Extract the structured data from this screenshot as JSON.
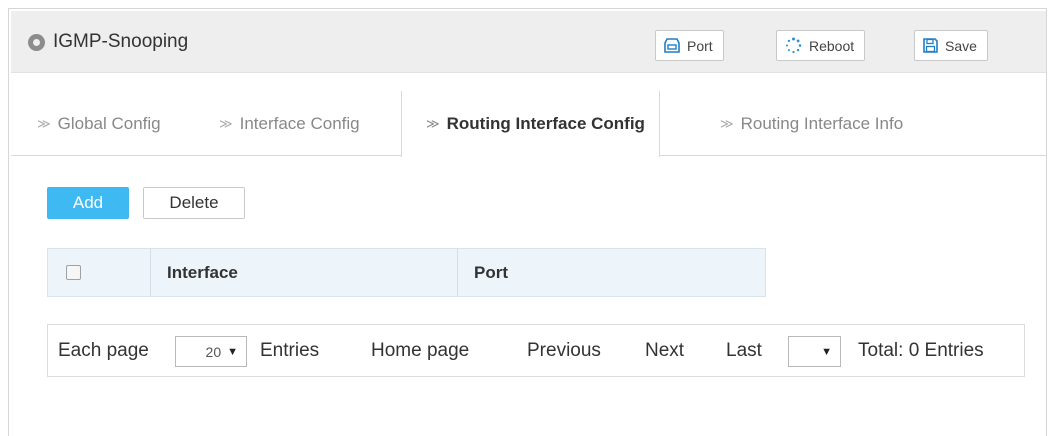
{
  "header": {
    "title": "IGMP-Snooping",
    "buttons": {
      "port": "Port",
      "reboot": "Reboot",
      "save": "Save"
    }
  },
  "tabs": [
    {
      "label": "Global Config"
    },
    {
      "label": "Interface Config"
    },
    {
      "label": "Routing Interface Config",
      "active": true
    },
    {
      "label": "Routing Interface Info"
    }
  ],
  "actions": {
    "add": "Add",
    "delete": "Delete"
  },
  "table": {
    "columns": [
      "Interface",
      "Port"
    ],
    "rows": []
  },
  "pagination": {
    "each_page_label": "Each page",
    "page_size": "20",
    "entries_label": "Entries",
    "home_page": "Home page",
    "previous": "Previous",
    "next": "Next",
    "last": "Last",
    "page_select_value": "",
    "total": "Total: 0 Entries"
  },
  "colors": {
    "accent": "#3fb9f1",
    "header_bg": "#eeeeee",
    "table_header_bg": "#edf5fa"
  },
  "icons": {
    "header_dot": "location-dot-icon",
    "port": "port-icon",
    "reboot": "reboot-spinner-icon",
    "save": "floppy-disk-icon",
    "tab_arrow": "double-chevron-right-icon",
    "select_caret": "caret-down-icon"
  }
}
